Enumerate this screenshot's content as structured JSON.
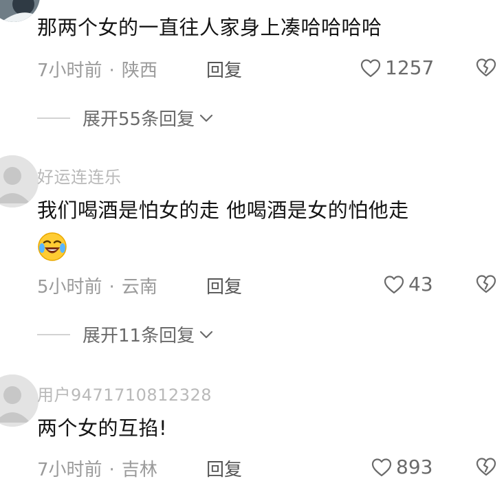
{
  "comments": [
    {
      "text": "那两个女的一直往人家身上凑哈哈哈哈",
      "time": "7小时前",
      "location": "陕西",
      "reply_label": "回复",
      "likes": "1257",
      "expand_label": "展开55条回复"
    },
    {
      "username": "好运连连乐",
      "text": "我们喝酒是怕女的走  他喝酒是女的怕他走",
      "emoji_icon": "laughing-tears-emoji",
      "time": "5小时前",
      "location": "云南",
      "reply_label": "回复",
      "likes": "43",
      "expand_label": "展开11条回复"
    },
    {
      "username": "用户9471710812328",
      "text": "两个女的互掐!",
      "time": "7小时前",
      "location": "吉林",
      "reply_label": "回复",
      "likes": "893"
    }
  ],
  "meta_separator": "·",
  "icons": {
    "like": "heart-outline-icon",
    "dislike": "broken-heart-icon",
    "expand": "chevron-down-icon",
    "avatar": "default-avatar-icon"
  },
  "colors": {
    "text_primary": "#141414",
    "text_secondary": "#9a9a9a",
    "username": "#b9b9b9",
    "icon": "#6a6a6a"
  }
}
